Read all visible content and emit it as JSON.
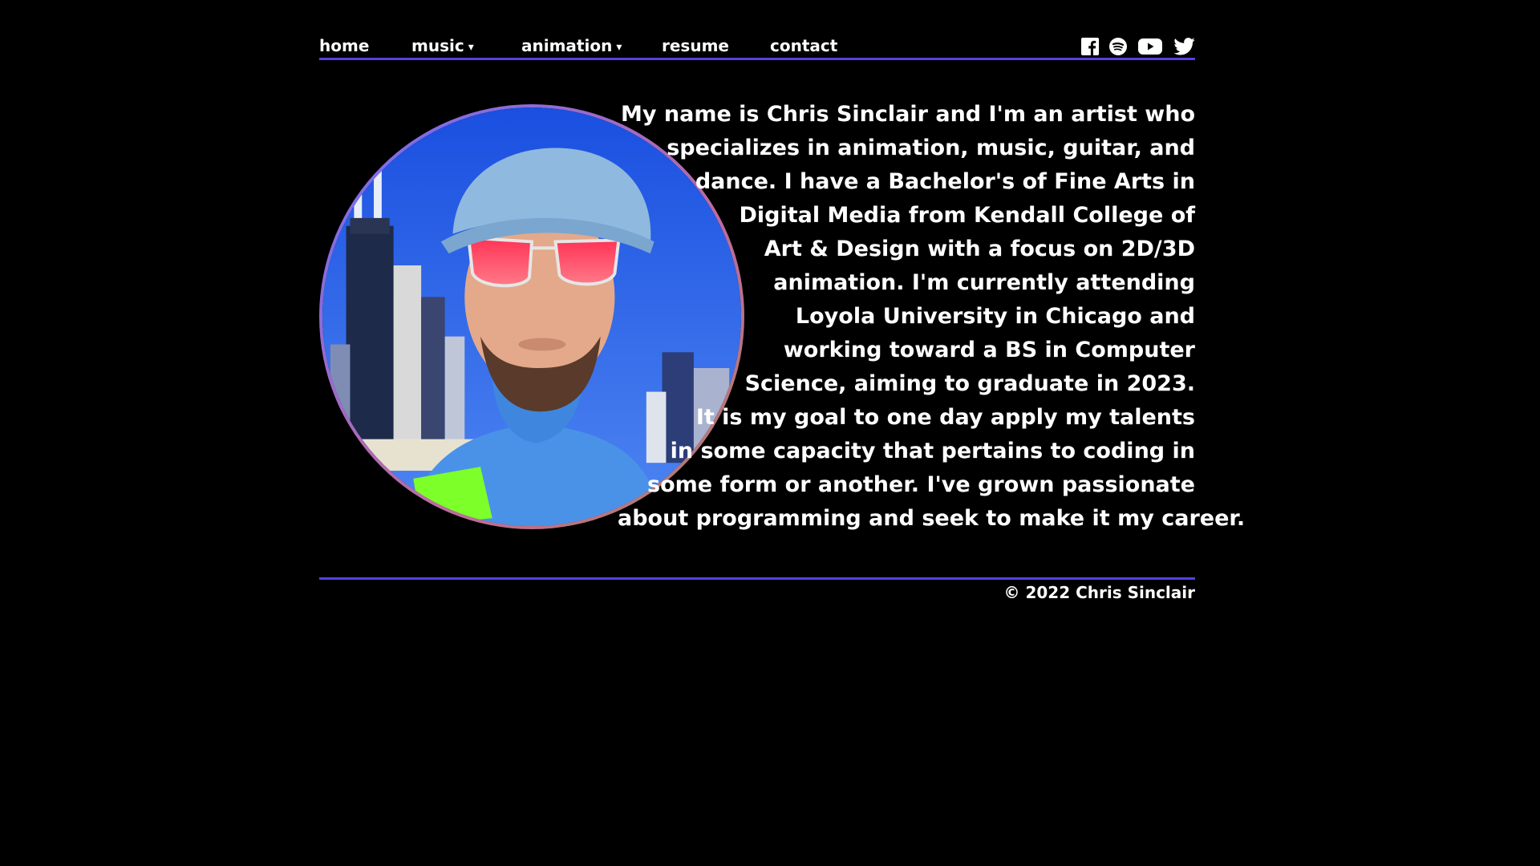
{
  "nav": {
    "items": [
      {
        "label": "home",
        "has_dropdown": false
      },
      {
        "label": "music",
        "has_dropdown": true
      },
      {
        "label": "animation",
        "has_dropdown": true
      },
      {
        "label": "resume",
        "has_dropdown": false
      },
      {
        "label": "contact",
        "has_dropdown": false
      }
    ],
    "dropdown_caret": "▾"
  },
  "social": {
    "icons": [
      "facebook-icon",
      "spotify-icon",
      "youtube-icon",
      "twitter-icon"
    ]
  },
  "bio": {
    "lines": [
      "My name is Chris Sinclair and I'm an artist who",
      "specializes in animation, music, guitar, and",
      "dance. I have a Bachelor's of Fine Arts in",
      "Digital Media from Kendall College of",
      "Art & Design with a focus on 2D/3D",
      "animation. I'm currently attending",
      "Loyola University in Chicago and",
      "working toward a BS in Computer",
      "Science, aiming to graduate in 2023.",
      "It is my goal to one day apply my talents",
      "in some capacity that pertains to coding in",
      "some form or another. I've grown passionate",
      "about programming and seek to make it my career."
    ]
  },
  "footer": {
    "copyright": "© 2022 Chris Sinclair"
  },
  "colors": {
    "background": "#000000",
    "accent_line": "#5542e0",
    "text": "#ffffff"
  }
}
